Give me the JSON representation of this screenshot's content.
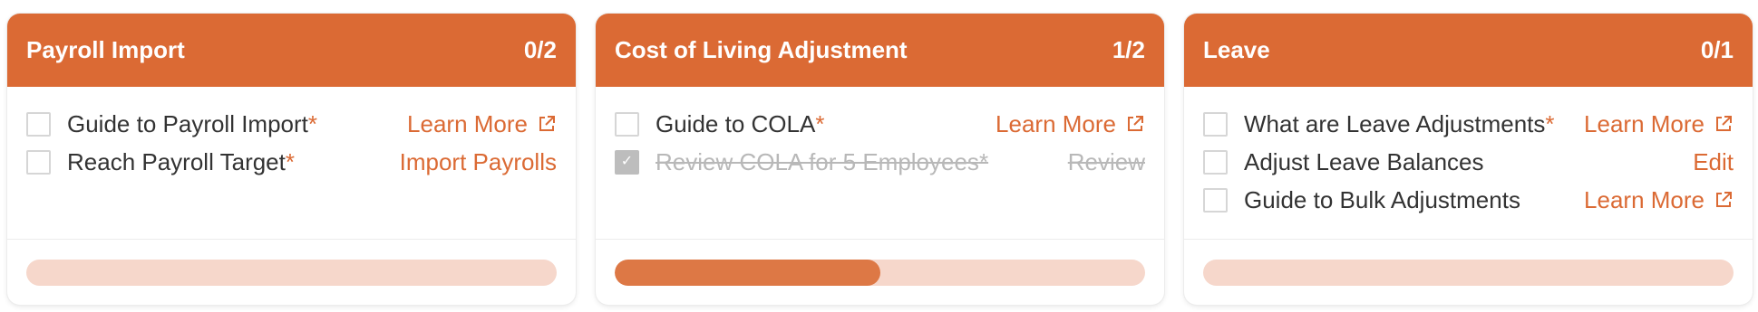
{
  "colors": {
    "accent": "#db6a34",
    "track": "#f6d7cb",
    "fill": "#dd7845",
    "done_text": "#b8b8b8"
  },
  "cards": [
    {
      "title": "Payroll Import",
      "count": "0/2",
      "progress": 0,
      "tasks": [
        {
          "label": "Guide to Payroll Import",
          "required": "*",
          "action": "Learn More",
          "action_icon": "external-link-icon",
          "done": false
        },
        {
          "label": "Reach Payroll Target",
          "required": "*",
          "action": "Import Payrolls",
          "done": false
        }
      ]
    },
    {
      "title": "Cost of Living Adjustment",
      "count": "1/2",
      "progress": 0.5,
      "tasks": [
        {
          "label": "Guide to COLA",
          "required": "*",
          "action": "Learn More",
          "action_icon": "external-link-icon",
          "done": false
        },
        {
          "label": "Review COLA for 5 Employees",
          "required": "*",
          "action": "Review",
          "done": true
        }
      ]
    },
    {
      "title": "Leave",
      "count": "0/1",
      "progress": 0,
      "tasks": [
        {
          "label": "What are Leave Adjustments",
          "required": "*",
          "action": "Learn More",
          "action_icon": "external-link-icon",
          "done": false
        },
        {
          "label": "Adjust Leave Balances",
          "action": "Edit",
          "done": false
        },
        {
          "label": "Guide to Bulk Adjustments",
          "action": "Learn More",
          "action_icon": "external-link-icon",
          "done": false
        }
      ]
    }
  ]
}
